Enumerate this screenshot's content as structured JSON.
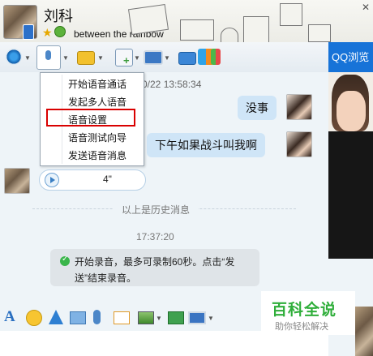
{
  "header": {
    "contact_name": "刘科",
    "status_text": "between the rainbow",
    "close_glyph": "✕",
    "icons": [
      "avatar",
      "phone-icon",
      "star-icon",
      "status-icon"
    ]
  },
  "toolbar": {
    "icons": [
      "video-icon",
      "microphone-icon",
      "folder-icon",
      "add-app-icon",
      "remote-desktop-icon",
      "share-screen-icon",
      "apps-grid-icon"
    ]
  },
  "voice_menu": {
    "items": [
      "开始语音通话",
      "发起多人语音",
      "语音设置",
      "语音测试向导",
      "发送语音消息"
    ],
    "highlighted_index": 2
  },
  "chat": {
    "first_time": "0/22 13:58:34",
    "messages": [
      {
        "text": "没事",
        "side": "right"
      },
      {
        "text": "下午如果战斗叫我啊",
        "side": "right"
      }
    ],
    "voice_message": {
      "duration": "4\""
    },
    "history_label": "以上是历史消息",
    "second_time": "17:37:20",
    "notice": "开始录音，最多可录制60秒。点击“发送”结束录音。"
  },
  "ad_panel": {
    "title": "QQ浏览"
  },
  "input_toolbar": {
    "font_label": "A",
    "icons": [
      "font-icon",
      "emoji-icon",
      "magic-icon",
      "screenshot-icon",
      "microphone-icon",
      "message-icon",
      "image-icon",
      "music-icon",
      "screen-icon"
    ]
  },
  "watermark": {
    "main": "百科全说",
    "sub": "助你轻松解决"
  },
  "colors": {
    "accent": "#1773d8",
    "bubble": "#cfe5f7",
    "highlight": "#d90000",
    "watermark": "#2fae3a"
  }
}
